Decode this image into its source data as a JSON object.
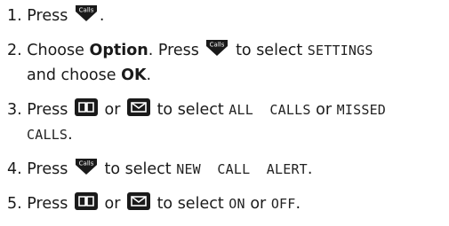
{
  "steps": [
    {
      "number": "1.",
      "intro": "Press",
      "icon": "calls-key-icon",
      "end": "."
    },
    {
      "number": "2.",
      "a": "Choose",
      "option": "Option",
      "b": ". Press",
      "icon": "calls-key-icon",
      "c": "to select",
      "settings": "SETTINGS",
      "d": "and choose",
      "ok": "OK",
      "end": "."
    },
    {
      "number": "3.",
      "a": "Press",
      "icon_up": "phonebook-key-icon",
      "or": "or",
      "icon_down": "envelope-key-icon",
      "b": "to select",
      "all_calls": "ALL  CALLS",
      "or2": "or",
      "missed": "MISSED",
      "calls": "CALLS",
      "end": "."
    },
    {
      "number": "4.",
      "a": "Press",
      "icon": "calls-key-icon",
      "b": "to select",
      "alert": "NEW  CALL  ALERT",
      "end": "."
    },
    {
      "number": "5.",
      "a": "Press",
      "icon_up": "phonebook-key-icon",
      "or": "or",
      "icon_down": "envelope-key-icon",
      "b": "to select",
      "on": "ON",
      "or2": "or",
      "off": "OFF",
      "end": "."
    }
  ],
  "icons": {
    "calls_key_label": "Calls",
    "key_color": "#1a1a1a"
  }
}
